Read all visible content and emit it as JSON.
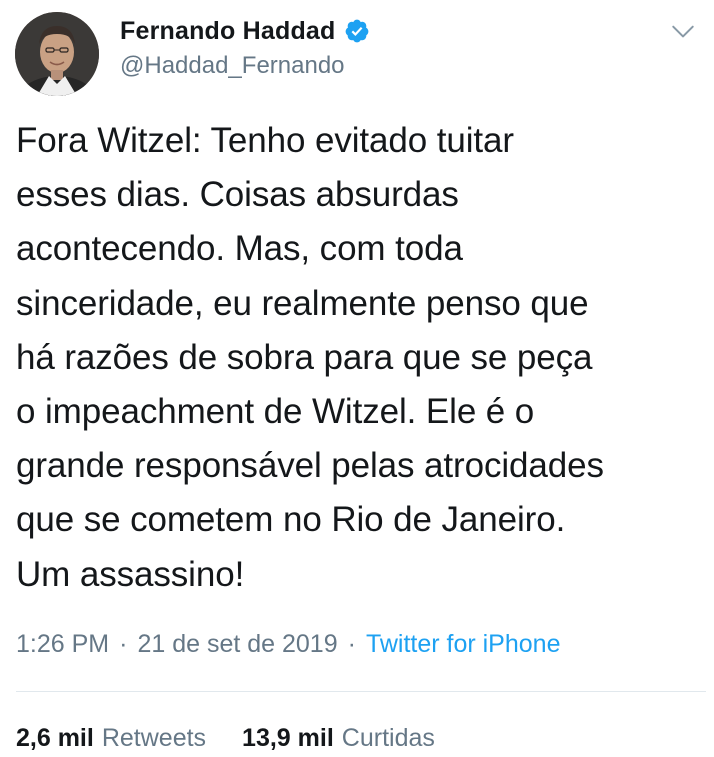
{
  "tweet": {
    "author": {
      "display_name": "Fernando Haddad",
      "handle": "@Haddad_Fernando",
      "verified": true,
      "avatar_icon": "profile-photo"
    },
    "menu_icon": "chevron-down-icon",
    "text": "Fora Witzel: Tenho evitado tuitar\nesses dias. Coisas absurdas\nacontecendo. Mas, com toda\nsinceridade, eu realmente penso que\nhá razões de sobra para que se peça\no impeachment de Witzel. Ele é o\ngrande responsável pelas atrocidades\nque se cometem no Rio de Janeiro.\nUm assassino!",
    "time": "1:26 PM",
    "separator": "·",
    "date": "21 de set de 2019",
    "source": "Twitter for iPhone",
    "stats": {
      "retweets_count": "2,6 mil",
      "retweets_label": "Retweets",
      "likes_count": "13,9 mil",
      "likes_label": "Curtidas"
    }
  },
  "colors": {
    "text": "#14171a",
    "secondary": "#657786",
    "accent": "#1da1f2",
    "divider": "#e1e8ed"
  }
}
